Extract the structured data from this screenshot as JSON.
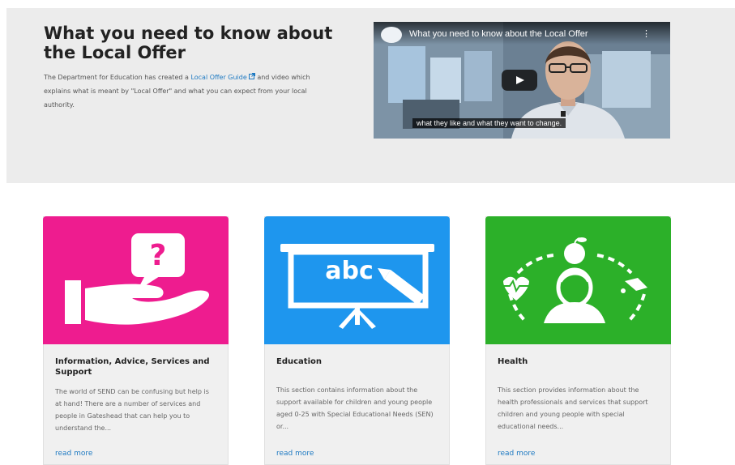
{
  "hero": {
    "title": "What you need to know about the Local Offer",
    "text_before": "The Department for Education has created a ",
    "link_label": "Local Offer Guide",
    "link_icon": "external-link-icon",
    "text_after": " and video which explains what is meant by \"Local Offer\" and what you can expect from your local authority."
  },
  "video": {
    "title": "What you need to know about the Local Offer",
    "menu_icon": "⋮",
    "play_icon": "play-icon",
    "caption": "what they like and what they want to change."
  },
  "cards": [
    {
      "title": "Information, Advice, Services and Support",
      "description": "The world of SEND can be confusing but help is at hand! There are a number of services and people in Gateshead that can help you to understand the...",
      "link": "read more",
      "color": "#ee1c8f",
      "icon": "hand-question-icon"
    },
    {
      "title": "Education",
      "description": "This section contains information about the support available for children and young people aged 0-25 with Special Educational Needs (SEN) or...",
      "link": "read more",
      "color": "#1e96ee",
      "icon": "abc-board-icon",
      "icon_text": "abc"
    },
    {
      "title": "Health",
      "description": "This section provides information about the health professionals and services that support children and young people with special educational needs...",
      "link": "read more",
      "color": "#2cb029",
      "icon": "health-person-icon"
    }
  ]
}
